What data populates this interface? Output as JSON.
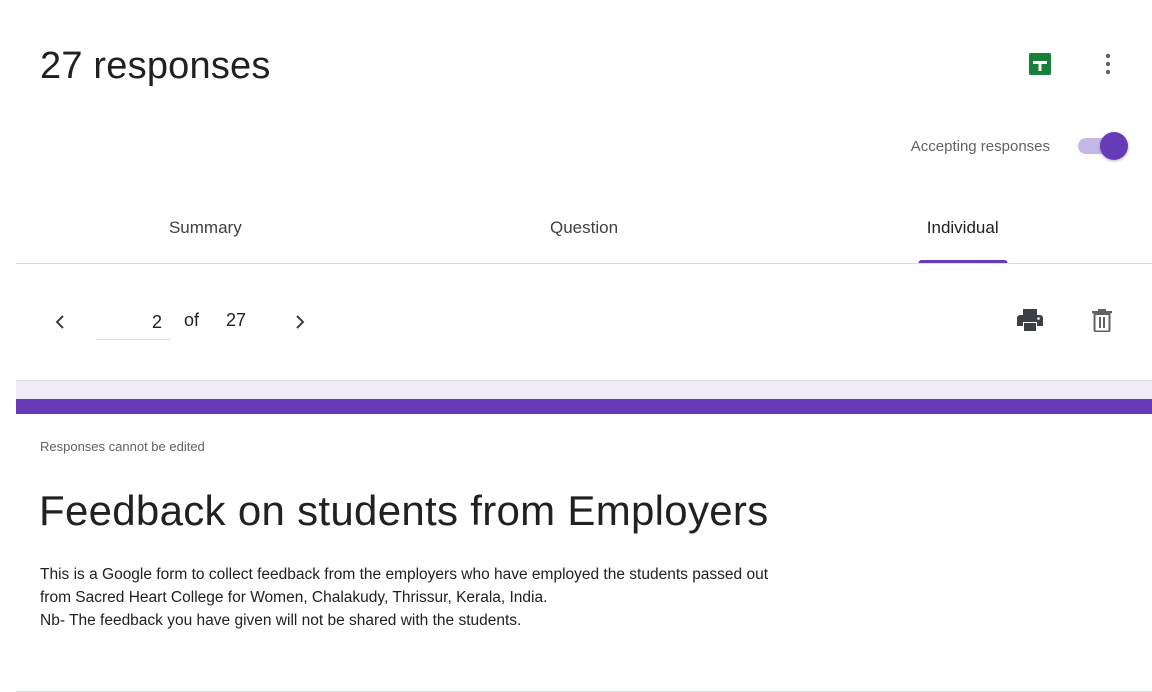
{
  "header": {
    "title": "27 responses",
    "accepting_label": "Accepting responses",
    "accepting_enabled": true,
    "sheets_icon": "google-sheets-icon",
    "more_icon": "more-vert-icon"
  },
  "tabs": [
    {
      "label": "Summary",
      "active": false
    },
    {
      "label": "Question",
      "active": false
    },
    {
      "label": "Individual",
      "active": true
    }
  ],
  "pager": {
    "current": "2",
    "of_label": "of",
    "total": "27",
    "prev_icon": "chevron-left-icon",
    "next_icon": "chevron-right-icon",
    "print_icon": "print-icon",
    "delete_icon": "trash-icon"
  },
  "form": {
    "note": "Responses cannot be edited",
    "title": "Feedback on students from Employers",
    "description_lines": [
      "This is a Google form to collect feedback from the employers who have employed the students passed out",
      "from Sacred Heart College for Women, Chalakudy, Thrissur, Kerala, India.",
      "Nb- The feedback you have given will not be shared with the students."
    ]
  },
  "colors": {
    "accent": "#673ab7",
    "sheets_green": "#188038",
    "background": "#f0ebf8"
  }
}
